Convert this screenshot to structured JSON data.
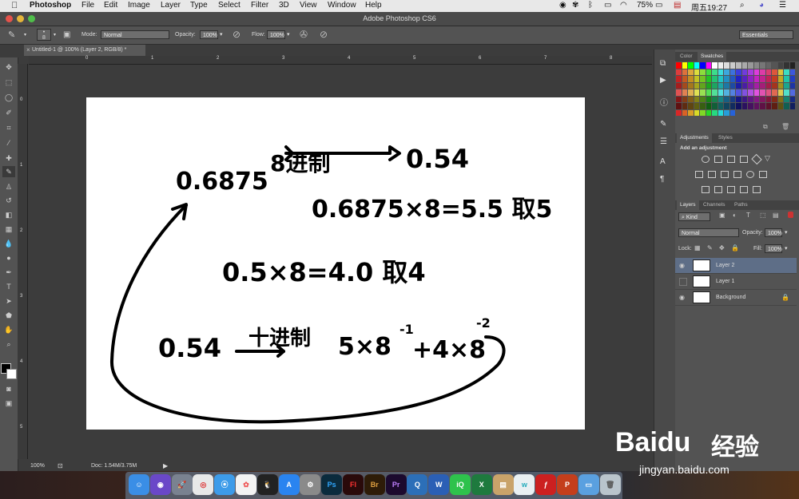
{
  "menubar": {
    "app": "Photoshop",
    "items": [
      "File",
      "Edit",
      "Image",
      "Layer",
      "Type",
      "Select",
      "Filter",
      "3D",
      "View",
      "Window",
      "Help"
    ],
    "battery": "75%",
    "clock": "周五19:27"
  },
  "window": {
    "title": "Adobe Photoshop CS6"
  },
  "options": {
    "brush_size": "8",
    "mode_label": "Mode:",
    "mode_value": "Normal",
    "opacity_label": "Opacity:",
    "opacity_value": "100%",
    "flow_label": "Flow:",
    "flow_value": "100%",
    "workspace": "Essentials"
  },
  "document": {
    "tab": "Untitled-1 @ 100% (Layer 2, RGB/8) *",
    "ruler_top": [
      "0",
      "1",
      "2",
      "3",
      "4",
      "5",
      "6",
      "7",
      "8"
    ],
    "ruler_left": [
      "0",
      "1",
      "2",
      "3",
      "4",
      "5"
    ],
    "zoom": "100%",
    "doc_info": "Doc: 1.54M/3.75M"
  },
  "canvas_text": {
    "l1a": "0.6875",
    "l1b": "8进制",
    "l1c": "0.54",
    "l2": "0.6875×8=5.5 取5",
    "l3": "0.5×8=4.0 取4",
    "l4a": "0.54",
    "l4b": "十进制",
    "l4c": "5×8",
    "l4d": "-1",
    "l4e": "+4×8",
    "l4f": "-2"
  },
  "panels": {
    "color_tab": "Color",
    "swatches_tab": "Swatches",
    "adjustments_tab": "Adjustments",
    "styles_tab": "Styles",
    "add_adjustment": "Add an adjustment",
    "layers_tab": "Layers",
    "channels_tab": "Channels",
    "paths_tab": "Paths",
    "kind": "Kind",
    "blend": "Normal",
    "opacity_label": "Opacity:",
    "opacity_value": "100%",
    "lock_label": "Lock:",
    "fill_label": "Fill:",
    "fill_value": "100%",
    "layers": [
      {
        "name": "Layer 2",
        "selected": true,
        "visible": true
      },
      {
        "name": "Layer 1",
        "selected": false,
        "visible": false
      },
      {
        "name": "Background",
        "selected": false,
        "visible": true
      }
    ]
  },
  "dock": {
    "icons": [
      "finder",
      "siri",
      "launchpad",
      "chrome",
      "safari",
      "photos",
      "qq",
      "app-store",
      "preferences",
      "Ps",
      "Fl",
      "Br",
      "Pr",
      "quicktime",
      "W",
      "iQIYI",
      "X",
      "archive",
      "wechat",
      "flash",
      "P",
      "folder",
      "trash"
    ]
  },
  "watermark": {
    "brand": "Baidu",
    "brand_cn": "经验",
    "url": "jingyan.baidu.com"
  }
}
